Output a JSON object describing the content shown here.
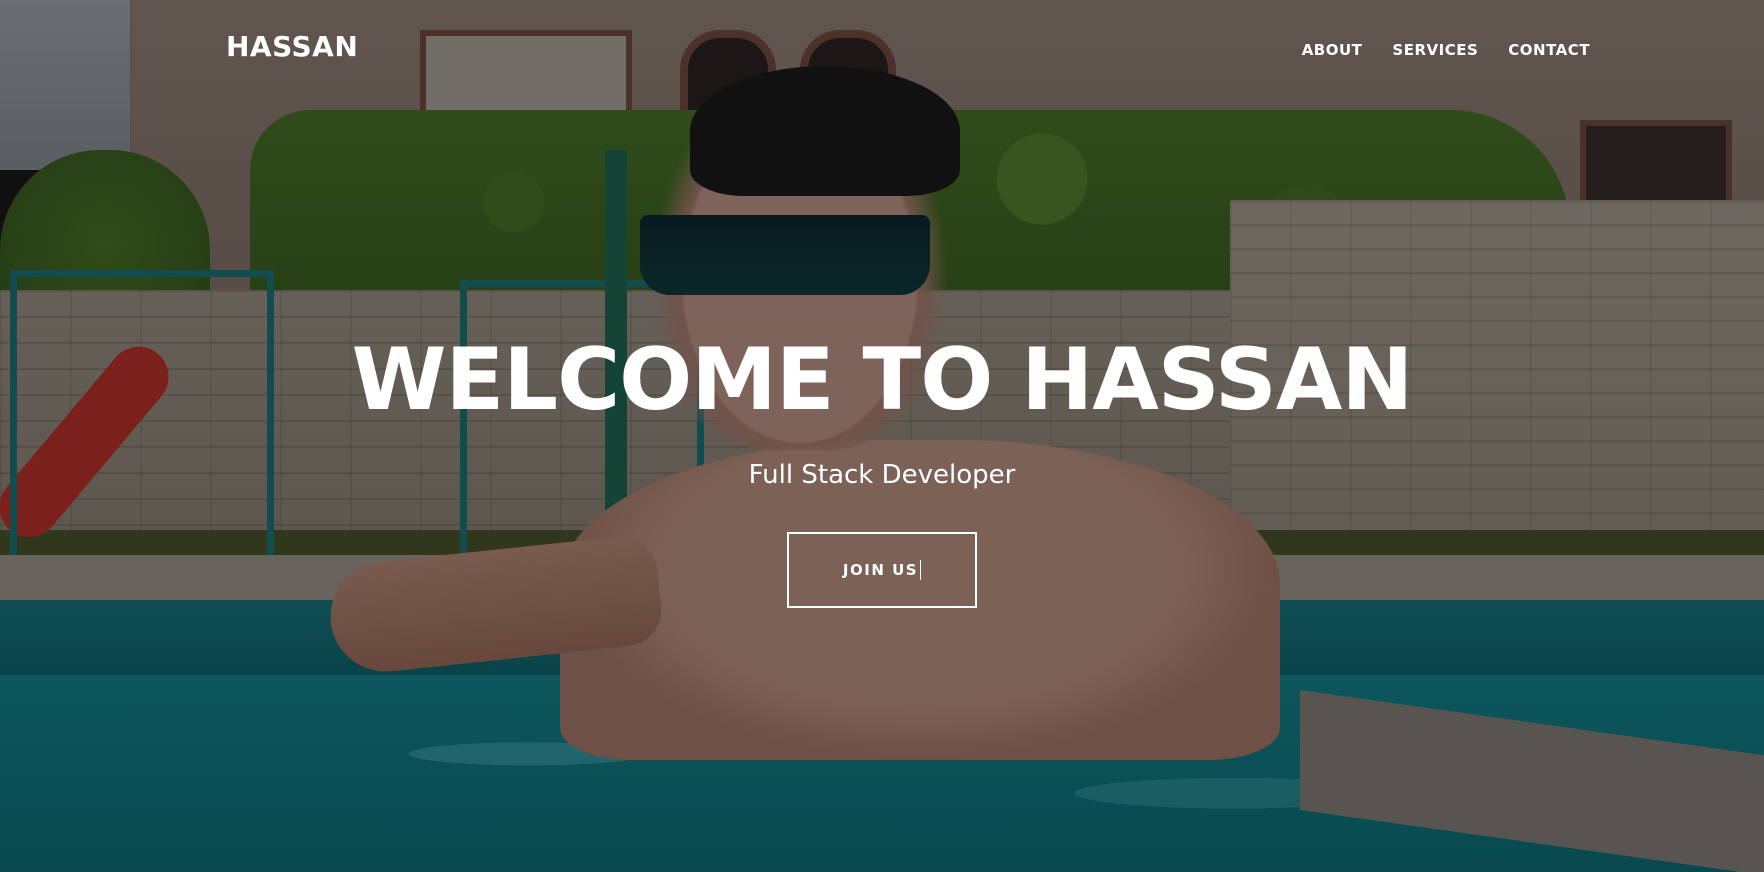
{
  "navbar": {
    "logo": "HASSAN",
    "links": [
      {
        "label": "ABOUT"
      },
      {
        "label": "SERVICES"
      },
      {
        "label": "CONTACT"
      }
    ]
  },
  "hero": {
    "title": "WELCOME TO HASSAN",
    "subtitle": "Full Stack Developer",
    "cta_label": "JOIN US"
  },
  "colors": {
    "text": "#ffffff",
    "overlay": "rgba(0,0,0,0.38)",
    "pool": "#168c97",
    "hedge": "#4d7a2b"
  }
}
